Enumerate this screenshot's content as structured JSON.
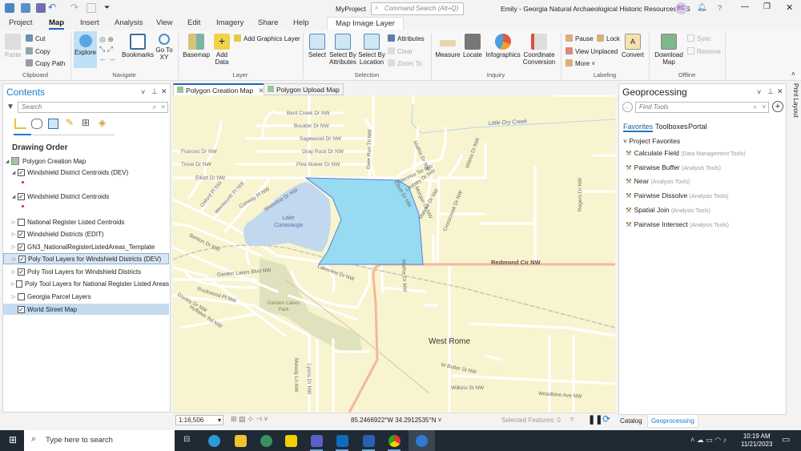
{
  "titlebar": {
    "project": "MyProject",
    "command_search_placeholder": "Command Search (Alt+Q)",
    "title": "Emily - Georgia Natural Archaeological Historic Resources GIS",
    "avatar": "EC",
    "help": "?"
  },
  "tabs": [
    "Project",
    "Map",
    "Insert",
    "Analysis",
    "View",
    "Edit",
    "Imagery",
    "Share",
    "Help",
    "Map Image Layer"
  ],
  "ribbon": {
    "clipboard": {
      "label": "Clipboard",
      "paste": "Paste",
      "cut": "Cut",
      "copy": "Copy",
      "copy_path": "Copy Path"
    },
    "navigate": {
      "label": "Navigate",
      "explore": "Explore",
      "bookmarks": "Bookmarks",
      "go_to_xy": "Go To XY"
    },
    "layer": {
      "label": "Layer",
      "basemap": "Basemap",
      "add_data": "Add Data",
      "add_graphics_layer": "Add Graphics Layer"
    },
    "selection": {
      "label": "Selection",
      "select": "Select",
      "select_by_attributes": "Select By Attributes",
      "select_by_location": "Select By Location",
      "attributes": "Attributes",
      "clear": "Clear",
      "zoom_to": "Zoom To"
    },
    "inquiry": {
      "label": "Inquiry",
      "measure": "Measure",
      "locate": "Locate",
      "infographics": "Infographics",
      "coordinate_conversion": "Coordinate Conversion"
    },
    "labeling": {
      "label": "Labeling",
      "pause": "Pause",
      "lock": "Lock",
      "view_unplaced": "View Unplaced",
      "more": "More",
      "convert": "Convert"
    },
    "offline": {
      "label": "Offline",
      "download_map": "Download Map",
      "sync": "Sync",
      "remove": "Remove"
    }
  },
  "contents": {
    "title": "Contents",
    "search_placeholder": "Search",
    "section": "Drawing Order",
    "map_name": "Polygon Creation Map",
    "layers": [
      {
        "name": "Windshield District Centroids (DEV)",
        "checked": true
      },
      {
        "name": "Windshield District Centroids",
        "checked": true
      },
      {
        "name": "National Register Listed Centroids",
        "checked": false
      },
      {
        "name": "Windshield Districts (EDIT)",
        "checked": true
      },
      {
        "name": "GN3_NationalRegisterListedAreas_Template",
        "checked": true
      },
      {
        "name": "Poly Tool Layers for Windshield Districts (DEV)",
        "checked": true
      },
      {
        "name": "Poly Tool Layers for Windshield Districts",
        "checked": true
      },
      {
        "name": "Poly Tool Layers for National Register Listed Areas",
        "checked": false
      },
      {
        "name": "Georgia Parcel Layers",
        "checked": false
      },
      {
        "name": "World Street Map",
        "checked": true
      }
    ]
  },
  "map_tabs": [
    "Polygon Creation Map",
    "Polygon Upload Map"
  ],
  "map": {
    "labels": {
      "bent_creek": "Bent Creek Dr NW",
      "boulder": "Boulder Dr NW",
      "sagewood": "Sagewood Dr NW",
      "gray_rock": "Gray Rock Dr NW",
      "pine_bower": "Pine Bower Dr NW",
      "frances": "Frances Dr NW",
      "trove": "Trove Dr NW",
      "elliott": "Elliott Dr NW",
      "oxford": "Oxford Pl NW",
      "wentworth": "Wentworth Pl NW",
      "conway": "Conway Pl NW",
      "shoreline": "Shoreline Dr NW",
      "deer_run": "Deer Run Trl NW",
      "lake1": "Lake",
      "lake2": "Conasauga",
      "creek": "Little Dry Creek",
      "mathis": "Mathis Dr NW",
      "glenrise": "Glenrise Ter NW",
      "lindsey": "Lindsey Dr NW",
      "malone": "Malone Dr NW",
      "crosscreek": "Crosscreek Dr NW",
      "morgan": "Morgan Dr NW",
      "wilma": "Wilma Dr NW",
      "rogers": "Rogers Dr NW",
      "redmond": "Redmond Cir NW",
      "garden_blvd": "Garden Lakes Blvd NW",
      "lakeview": "Lakeview Dr NW",
      "rockwood": "Rockwood Pl NW",
      "dooley": "Dooley Dr NW",
      "huffaker": "Huffaker Rd NW",
      "benton": "Benton Dr NW",
      "park1": "Garden Lakes",
      "park2": "Park",
      "west_rome": "West Rome",
      "butler": "W Butler St NW",
      "wilkins": "Wilkins St NW",
      "woodbine": "Woodbine Ave NW",
      "melody": "Melody Ln NW",
      "lyons": "Lyons Dr NW"
    }
  },
  "status": {
    "scale": "1:16,506",
    "coordinates": "85.2466922°W 34.2912535°N",
    "selected_features": "Selected Features: 0"
  },
  "geoprocessing": {
    "title": "Geoprocessing",
    "search_placeholder": "Find Tools",
    "tabs": [
      "Favorites",
      "Toolboxes",
      "Portal"
    ],
    "section": "Project Favorites",
    "tools": [
      {
        "name": "Calculate Field",
        "toolbox": "(Data Management Tools)"
      },
      {
        "name": "Pairwise Buffer",
        "toolbox": "(Analysis Tools)"
      },
      {
        "name": "Near",
        "toolbox": "(Analysis Tools)"
      },
      {
        "name": "Pairwise Dissolve",
        "toolbox": "(Analysis Tools)"
      },
      {
        "name": "Spatial Join",
        "toolbox": "(Analysis Tools)"
      },
      {
        "name": "Pairwise Intersect",
        "toolbox": "(Analysis Tools)"
      }
    ],
    "bottom_tabs": [
      "Catalog",
      "Geoprocessing"
    ]
  },
  "side_tab": "Print Layout",
  "taskbar": {
    "search_placeholder": "Type here to search",
    "time": "10:19 AM",
    "date": "11/21/2023"
  },
  "colors": {
    "accent": "#1a66b5",
    "polygon_fill": "#97dbf2",
    "polygon_stroke": "#5a7fd6",
    "lake": "#c1d8ef",
    "map_bg": "#f8f4d0",
    "park": "#dfe2bd",
    "major_road": "#f2b89a"
  }
}
